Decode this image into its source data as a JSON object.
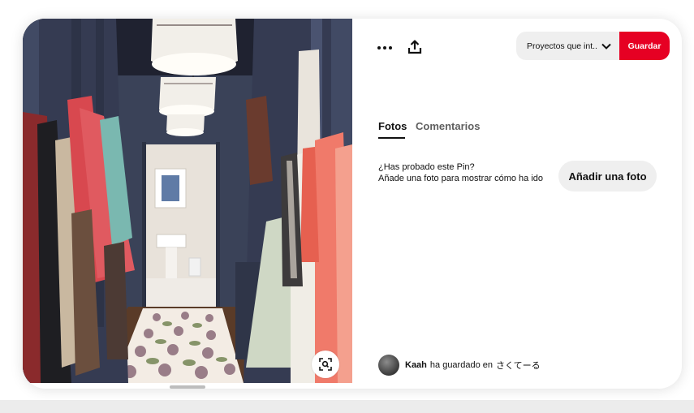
{
  "photo": {
    "alt": "",
    "visual_search_icon": "lens-search-icon"
  },
  "toolbar": {
    "more_icon": "ellipsis-icon",
    "share_icon": "share-upload-icon",
    "board_select_label": "Proyectos que int...",
    "board_select_icon": "chevron-down-icon",
    "save_label": "Guardar",
    "save_color": "#e60023"
  },
  "tabs": [
    {
      "label": "Fotos",
      "active": true
    },
    {
      "label": "Comentarios",
      "active": false
    }
  ],
  "tried": {
    "line1": "¿Has probado este Pin?",
    "line2": "Añade una foto para mostrar cómo ha ido",
    "button": "Añadir una foto"
  },
  "saved_by": {
    "user": "Kaah",
    "text": "ha guardado en",
    "board": "さくてーる"
  }
}
